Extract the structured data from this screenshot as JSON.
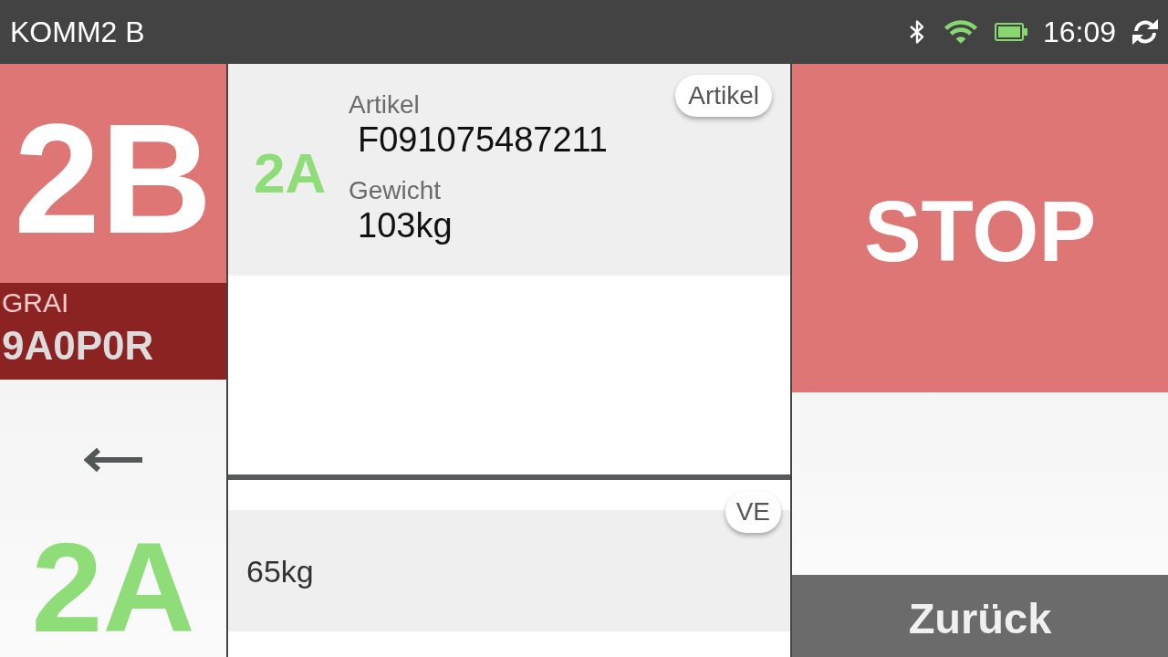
{
  "status_bar": {
    "title": "KOMM2 B",
    "time": "16:09"
  },
  "source": {
    "code": "2B",
    "grai_label": "GRAI",
    "grai_value": "9A0P0R"
  },
  "target": {
    "code": "2A"
  },
  "article": {
    "slot": "2A",
    "chip": "Artikel",
    "fields": [
      {
        "label": "Artikel",
        "value": "F091075487211"
      },
      {
        "label": "Gewicht",
        "value": "103kg"
      }
    ]
  },
  "unit": {
    "chip": "VE",
    "value": "65kg"
  },
  "stop_button": {
    "label": "STOP"
  },
  "back_button": {
    "label": "Zurück"
  }
}
